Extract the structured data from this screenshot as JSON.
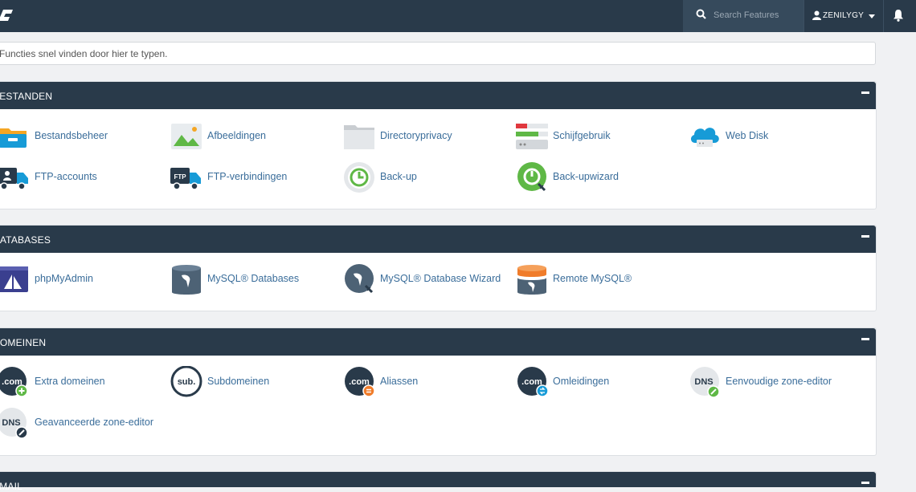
{
  "header": {
    "logo": "cP",
    "search_placeholder": "Search Features",
    "username": "ZENILYGY"
  },
  "quick_find": {
    "placeholder": "Functies snel vinden door hier te typen."
  },
  "panels": {
    "bestanden": {
      "title": "BESTANDEN",
      "items": [
        "Bestandsbeheer",
        "Afbeeldingen",
        "Directoryprivacy",
        "Schijfgebruik",
        "Web Disk",
        "FTP-accounts",
        "FTP-verbindingen",
        "Back-up",
        "Back-upwizard"
      ]
    },
    "databases": {
      "title": "DATABASES",
      "items": [
        "phpMyAdmin",
        "MySQL® Databases",
        "MySQL® Database Wizard",
        "Remote MySQL®"
      ]
    },
    "domeinen": {
      "title": "DOMEINEN",
      "items": [
        "Extra domeinen",
        "Subdomeinen",
        "Aliassen",
        "Omleidingen",
        "Eenvoudige zone-editor",
        "Geavanceerde zone-editor"
      ]
    },
    "email": {
      "title": "EMAIL"
    }
  },
  "icon_text": {
    "ftp": "FTP",
    "dotcom": ".com",
    "sub": "sub.",
    "dns": "DNS"
  },
  "colors": {
    "header_bg": "#293a4a",
    "link": "#3a6d9a",
    "accent_blue": "#179bd7",
    "accent_green": "#5fb846",
    "accent_orange": "#f07c2a"
  }
}
